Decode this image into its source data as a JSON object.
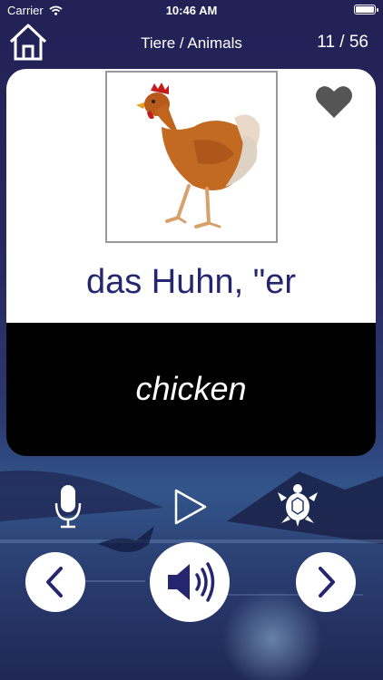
{
  "status_bar": {
    "carrier": "Carrier",
    "time": "10:46 AM",
    "battery_level": 1.0
  },
  "nav": {
    "title": "Tiere / Animals",
    "counter": "11 / 56",
    "home_icon": "home-icon"
  },
  "card": {
    "image": "chicken-photo",
    "favorite_icon": "heart-icon",
    "word": "das Huhn, \"er",
    "translation": "chicken"
  },
  "controls": {
    "record_icon": "microphone-icon",
    "play_icon": "play-icon",
    "slow_icon": "turtle-icon",
    "prev_icon": "chevron-left-icon",
    "audio_icon": "speaker-icon",
    "next_icon": "chevron-right-icon"
  },
  "colors": {
    "word": "#262670",
    "card_bottom": "#000000",
    "card_top": "#ffffff",
    "accent_icon": "#262670"
  }
}
